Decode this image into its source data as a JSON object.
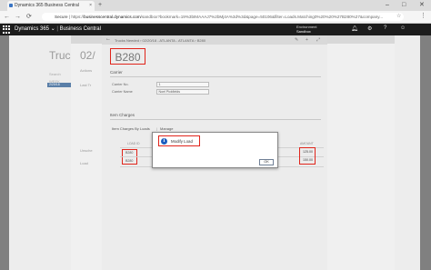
{
  "browser": {
    "tab_title": "Dynamics 365 Business Central",
    "tab_close": "×",
    "new_tab": "+",
    "url_secure": "Secure",
    "url_host": "businesscentral.dynamics.com",
    "url_rest": "/sandbox?bookmark=19%3bIMAAAJ7%2bMj4A%3d%3d&page=50106&filter=Loads.Matching0%20%20%27B280%27&company...",
    "window_min": "–",
    "window_max": "□",
    "window_close": "✕"
  },
  "app": {
    "product": "Dynamics 365",
    "product_chevron": "⌄",
    "area": "Business Central",
    "env_label": "Environment",
    "env_value": "Sandbox"
  },
  "underlying": {
    "p1_title": "Truc",
    "p1_labels": [
      "Search",
      "WEEK"
    ],
    "p1_row": "2/20/18",
    "p2_title": "02/",
    "p2_labels": [
      "Actions",
      "Last Tr",
      "Unsche",
      "Load"
    ]
  },
  "card": {
    "breadcrumb": "Trucks Needed  ›  02/20/18 - ATLANTA - ATLANTA ›  B280",
    "title": "B280",
    "section_carrier": "Carrier",
    "carrier_no_label": "Carrier No.",
    "carrier_no_value": "1",
    "carrier_name_label": "Carrier Name",
    "carrier_name_value": "Noel Pickfields",
    "section_item_charges": "Item Charges",
    "item_charges_by_loads": "Item Charges By Loads",
    "manage": "Manage",
    "col_load": "LOAD ID",
    "col_amount": "AMOUNT",
    "rows": [
      {
        "load": "B280",
        "amount": "125.00"
      },
      {
        "load": "B280",
        "amount": "150.00"
      }
    ]
  },
  "dialog": {
    "icon": "i",
    "message": "Modify Load",
    "ok": "OK"
  },
  "colors": {
    "highlight": "#e0241b",
    "info": "#1c5dbf",
    "header": "#1c1c1c"
  }
}
